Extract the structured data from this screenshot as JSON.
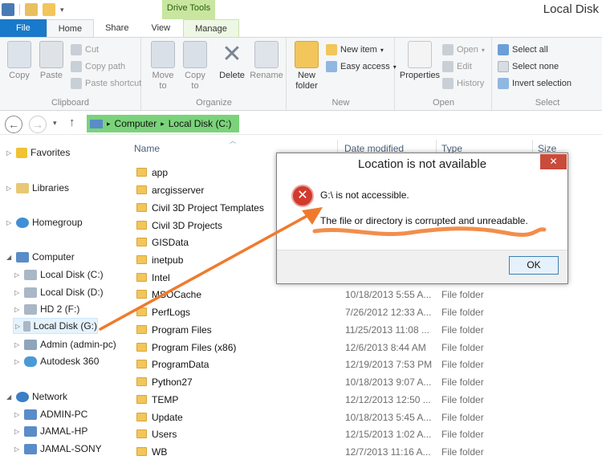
{
  "window": {
    "title": "Local Disk",
    "context_tab": "Drive Tools"
  },
  "tabs": [
    {
      "label": "File"
    },
    {
      "label": "Home"
    },
    {
      "label": "Share"
    },
    {
      "label": "View"
    },
    {
      "label": "Manage"
    }
  ],
  "ribbon": {
    "clipboard": {
      "label": "Clipboard",
      "copy": "Copy",
      "paste": "Paste",
      "cut": "Cut",
      "copy_path": "Copy path",
      "paste_shortcut": "Paste shortcut"
    },
    "organize": {
      "label": "Organize",
      "move_to": "Move",
      "move_to_2": "to",
      "copy_to": "Copy",
      "copy_to_2": "to",
      "delete": "Delete",
      "rename": "Rename"
    },
    "new": {
      "label": "New",
      "new_folder": "New",
      "new_folder_2": "folder",
      "new_item": "New item",
      "easy_access": "Easy access"
    },
    "open": {
      "label": "Open",
      "properties": "Properties",
      "open": "Open",
      "edit": "Edit",
      "history": "History"
    },
    "select": {
      "label": "Select",
      "select_all": "Select all",
      "select_none": "Select none",
      "invert": "Invert selection"
    }
  },
  "address": {
    "crumbs": [
      "Computer",
      "Local Disk (C:)"
    ]
  },
  "sidebar": {
    "favorites": "Favorites",
    "libraries": "Libraries",
    "homegroup": "Homegroup",
    "computer": "Computer",
    "drives": [
      "Local Disk (C:)",
      "Local Disk (D:)",
      "HD 2 (F:)",
      "Local Disk (G:)",
      "Admin (admin-pc)",
      "Autodesk 360"
    ],
    "network": "Network",
    "hosts": [
      "ADMIN-PC",
      "JAMAL-HP",
      "JAMAL-SONY"
    ]
  },
  "columns": {
    "name": "Name",
    "date": "Date modified",
    "type": "Type",
    "size": "Size"
  },
  "files": [
    {
      "name": "app",
      "date": "",
      "type": ""
    },
    {
      "name": "arcgisserver",
      "date": "",
      "type": ""
    },
    {
      "name": "Civil 3D Project Templates",
      "date": "",
      "type": ""
    },
    {
      "name": "Civil 3D Projects",
      "date": "",
      "type": ""
    },
    {
      "name": "GISData",
      "date": "",
      "type": ""
    },
    {
      "name": "inetpub",
      "date": "",
      "type": ""
    },
    {
      "name": "Intel",
      "date": "",
      "type": ""
    },
    {
      "name": "MSOCache",
      "date": "10/18/2013 5:55 A...",
      "type": "File folder"
    },
    {
      "name": "PerfLogs",
      "date": "7/26/2012 12:33 A...",
      "type": "File folder"
    },
    {
      "name": "Program Files",
      "date": "11/25/2013 11:08 ...",
      "type": "File folder"
    },
    {
      "name": "Program Files (x86)",
      "date": "12/6/2013 8:44 AM",
      "type": "File folder"
    },
    {
      "name": "ProgramData",
      "date": "12/19/2013 7:53 PM",
      "type": "File folder"
    },
    {
      "name": "Python27",
      "date": "10/18/2013 9:07 A...",
      "type": "File folder"
    },
    {
      "name": "TEMP",
      "date": "12/12/2013 12:50 ...",
      "type": "File folder"
    },
    {
      "name": "Update",
      "date": "10/18/2013 5:45 A...",
      "type": "File folder"
    },
    {
      "name": "Users",
      "date": "12/15/2013 1:02 A...",
      "type": "File folder"
    },
    {
      "name": "WB",
      "date": "12/7/2013 11:16 A...",
      "type": "File folder"
    }
  ],
  "dialog": {
    "title": "Location is not available",
    "close": "✕",
    "message": "G:\\ is not accessible.",
    "detail": "The file or directory is corrupted and unreadable.",
    "ok": "OK"
  },
  "colors": {
    "accent": "#1979ca",
    "highlight": "#7ad37a",
    "annotation": "#f07a2c",
    "error": "#d03b2e"
  }
}
